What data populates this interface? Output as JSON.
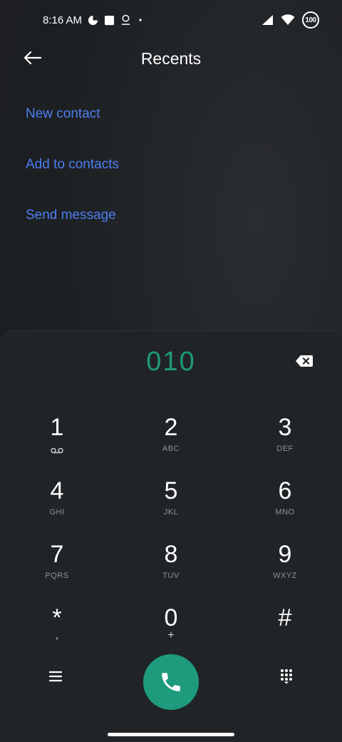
{
  "status_bar": {
    "time": "8:16 AM",
    "battery": "100",
    "icons": [
      "data-saver-icon",
      "notification-square-icon",
      "location-pin-icon",
      "dot-icon",
      "signal-icon",
      "wifi-icon",
      "battery-icon"
    ]
  },
  "header": {
    "back_icon": "arrow-left-icon",
    "title": "Recents"
  },
  "actions": {
    "new_contact": "New contact",
    "add_to_contacts": "Add to contacts",
    "send_message": "Send message"
  },
  "dialer": {
    "number": "010",
    "backspace_icon": "backspace-icon",
    "keys": [
      {
        "digit": "1",
        "sub": ""
      },
      {
        "digit": "2",
        "sub": "ABC"
      },
      {
        "digit": "3",
        "sub": "DEF"
      },
      {
        "digit": "4",
        "sub": "GHI"
      },
      {
        "digit": "5",
        "sub": "JKL"
      },
      {
        "digit": "6",
        "sub": "MNO"
      },
      {
        "digit": "7",
        "sub": "PQRS"
      },
      {
        "digit": "8",
        "sub": "TUV"
      },
      {
        "digit": "9",
        "sub": "WXYZ"
      },
      {
        "digit": "*",
        "sub": ","
      },
      {
        "digit": "0",
        "sub": "+"
      },
      {
        "digit": "#",
        "sub": ""
      }
    ],
    "menu_icon": "menu-icon",
    "call_icon": "phone-icon",
    "dialpad_icon": "dialpad-icon"
  },
  "colors": {
    "accent_link": "#4d7ef0",
    "accent_green": "#1e9a7c",
    "panel_bg": "#212427"
  }
}
